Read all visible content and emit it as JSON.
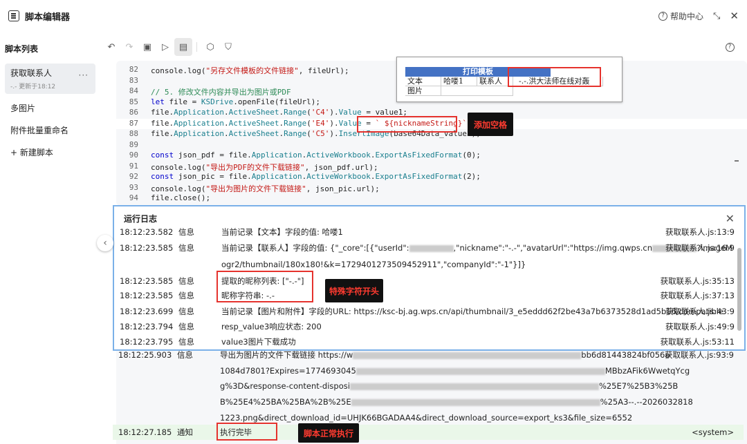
{
  "window": {
    "title": "脚本编辑器",
    "help_label": "帮助中心"
  },
  "sidebar": {
    "heading": "脚本列表",
    "items": [
      {
        "label": "获取联系人",
        "sub": "-.- 更新于18:12",
        "more": "···"
      },
      {
        "label": "多图片"
      },
      {
        "label": "附件批量重命名"
      },
      {
        "label": "+ 新建脚本"
      }
    ]
  },
  "code": [
    {
      "n": "82",
      "html": "console.log(<span class='str'>\"另存文件模板的文件链接\"</span>, fileUrl);"
    },
    {
      "n": "83",
      "html": ""
    },
    {
      "n": "84",
      "html": "<span class='cm'>// 5. 修改文件内容并导出为图片或PDF</span>"
    },
    {
      "n": "85",
      "html": "<span class='kw'>let</span> file = <span class='prop'>KSDrive</span>.openFile(fileUrl);"
    },
    {
      "n": "86",
      "html": "file.<span class='prop'>Application</span>.<span class='prop'>ActiveSheet</span>.<span class='prop'>Range</span>(<span class='str'>'C4'</span>).<span class='prop'>Value</span> = value1;"
    },
    {
      "n": "87",
      "html": "file.<span class='prop'>Application</span>.<span class='prop'>ActiveSheet</span>.<span class='prop'>Range</span>(<span class='str'>'E4'</span>).<span class='prop'>Value</span> = <span class='str'>` ${nicknameString}`</span>;"
    },
    {
      "n": "88",
      "html": "file.<span class='prop'>Application</span>.<span class='prop'>ActiveSheet</span>.<span class='prop'>Range</span>(<span class='str'>'C5'</span>).<span class='prop'>InsertImage</span>(base64Data_value3);"
    },
    {
      "n": "89",
      "html": ""
    },
    {
      "n": "90",
      "html": "<span class='kw'>const</span> json_pdf = file.<span class='prop'>Application</span>.<span class='prop'>ActiveWorkbook</span>.<span class='prop'>ExportAsFixedFormat</span>(0);"
    },
    {
      "n": "91",
      "html": "console.log(<span class='str'>\"导出为PDF的文件下载链接\"</span>, json_pdf.url);"
    },
    {
      "n": "92",
      "html": "<span class='kw'>const</span> json_pic = file.<span class='prop'>Application</span>.<span class='prop'>ActiveWorkbook</span>.<span class='prop'>ExportAsFixedFormat</span>(2);"
    },
    {
      "n": "93",
      "html": "console.log(<span class='str'>\"导出为图片的文件下载链接\"</span>, json_pic.url);"
    },
    {
      "n": "94",
      "html": "file.close();"
    }
  ],
  "sheet": {
    "title": "打印模板",
    "r1c1": "文本",
    "r1c2": "哈喽1",
    "r1c3": "联系人",
    "r1c4": "-.-.洪大法师在线对轰",
    "r2c1": "图片"
  },
  "annotations": {
    "add_space": "添加空格",
    "special_char": "特殊字符开头",
    "normal_run": "脚本正常执行"
  },
  "log": {
    "title": "运行日志",
    "rows": [
      {
        "t": "18:12:23.582",
        "lv": "信息",
        "msg": "当前记录【文本】字段的值: 哈喽1",
        "src": "获取联系人.js:13:9"
      },
      {
        "t": "18:12:23.585",
        "lv": "信息",
        "msg": "当前记录【联系人】字段的值: {\"_core\":[{\"userId\":",
        "msg2": ",\"nickname\":\"-.-\",\"avatarUrl\":\"https://img.qwps.cn",
        "msg3": "?imageM",
        "src": "获取联系人.js:16:9"
      },
      {
        "t": "",
        "lv": "",
        "msg": "ogr2/thumbnail/180x180!&k=1729401273509452911\",\"companyId\":\"-1\"}]}",
        "src": ""
      },
      {
        "t": "18:12:23.585",
        "lv": "信息",
        "msg": "提取的昵称列表: [\"-.-\"]",
        "src": "获取联系人.js:35:13"
      },
      {
        "t": "18:12:23.585",
        "lv": "信息",
        "msg": "昵称字符串: -.-",
        "src": "获取联系人.js:37:13"
      },
      {
        "t": "18:12:23.699",
        "lv": "信息",
        "msg": "当前记录【图片和附件】字段的URL: https://ksc-bj.ag.wps.cn/api/thumbnail/3_e5eddd62f2be43a7b6373528d1ad5b16/compatible",
        "src": "获取联系人.js:43:9"
      },
      {
        "t": "18:12:23.794",
        "lv": "信息",
        "msg": "resp_value3响应状态: 200",
        "src": "获取联系人.js:49:9"
      },
      {
        "t": "18:12:23.795",
        "lv": "信息",
        "msg": "value3图片下载成功",
        "src": "获取联系人.js:53:11"
      }
    ],
    "below": [
      {
        "t": "18:12:25.903",
        "lv": "信息",
        "msg": "导出为图片的文件下载链接 https://w",
        "msg_end": "bb6d81443824bf056a",
        "src": "获取联系人.js:93:9"
      },
      {
        "t": "",
        "lv": "",
        "msg": "1084d7801?Expires=1774693045",
        "msg_end": "MBbzAFik6WwetqYcg",
        "src": ""
      },
      {
        "t": "",
        "lv": "",
        "msg": "g%3D&response-content-disposi",
        "msg_end": "%25E7%25B3%25B",
        "src": ""
      },
      {
        "t": "",
        "lv": "",
        "msg": "B%25E4%25BA%25BA%2B%25E",
        "msg_end": "%25A3--.--2026032818",
        "src": ""
      },
      {
        "t": "",
        "lv": "",
        "msg": "1223.png&direct_download_id=UHJK66BGADAA4&direct_download_source=export_ks3&file_size=6552",
        "msg_end": "",
        "src": ""
      },
      {
        "t": "18:12:27.185",
        "lv": "通知",
        "msg": "执行完毕",
        "msg_end": "",
        "src": "<system>"
      }
    ]
  }
}
